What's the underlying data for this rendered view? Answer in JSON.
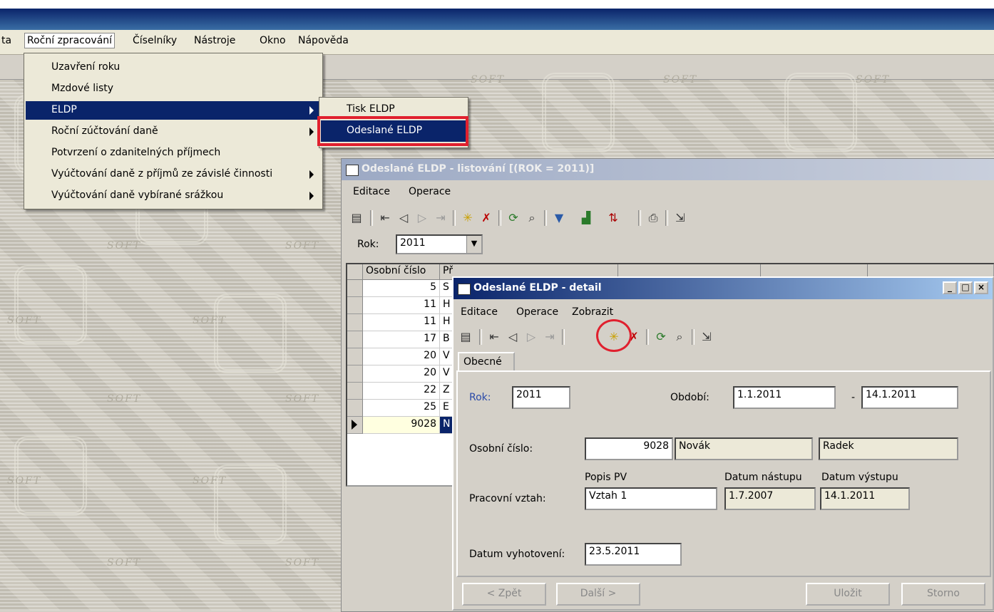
{
  "menubar": {
    "items": [
      "ta",
      "Roční zpracování",
      "Číselníky",
      "Nástroje",
      "Okno",
      "Nápověda"
    ]
  },
  "dropdown": {
    "items": [
      {
        "label": "Uzavření roku",
        "submenu": false
      },
      {
        "label": "Mzdové listy",
        "submenu": false
      },
      {
        "label": "ELDP",
        "submenu": true
      },
      {
        "label": "Roční zúčtování daně",
        "submenu": true
      },
      {
        "label": "Potvrzení o zdanitelných příjmech",
        "submenu": false
      },
      {
        "label": "Vyúčtování daně z příjmů ze závislé činnosti",
        "submenu": true
      },
      {
        "label": "Vyúčtování daně vybírané srážkou",
        "submenu": true
      }
    ]
  },
  "submenu": {
    "items": [
      "Tisk ELDP",
      "Odeslané ELDP"
    ]
  },
  "wallpaper": {
    "watermark": "SOFT"
  },
  "list_window": {
    "title": "Odeslané ELDP - listování [(ROK = 2011)]",
    "menu": [
      "Editace",
      "Operace"
    ],
    "filter_label": "Rok:",
    "filter_value": "2011",
    "columns": [
      "Osobní číslo",
      "Př",
      "",
      "",
      ""
    ],
    "rows": [
      {
        "id": "5",
        "p": "S"
      },
      {
        "id": "11",
        "p": "H"
      },
      {
        "id": "11",
        "p": "H"
      },
      {
        "id": "17",
        "p": "B"
      },
      {
        "id": "20",
        "p": "V"
      },
      {
        "id": "20",
        "p": "V"
      },
      {
        "id": "22",
        "p": "Z"
      },
      {
        "id": "25",
        "p": "E"
      },
      {
        "id": "9028",
        "p": "N"
      }
    ]
  },
  "detail_window": {
    "title": "Odeslané ELDP - detail",
    "menu": [
      "Editace",
      "Operace",
      "Zobrazit"
    ],
    "tab": "Obecné",
    "rok_label": "Rok:",
    "rok_value": "2011",
    "obdobi_label": "Období:",
    "obdobi_from": "1.1.2011",
    "obdobi_dash": "-",
    "obdobi_to": "14.1.2011",
    "osobni_label": "Osobní číslo:",
    "osobni_value": "9028",
    "prijmeni": "Novák",
    "jmeno": "Radek",
    "popis_pv_label": "Popis PV",
    "datum_nastupu_label": "Datum nástupu",
    "datum_vystupu_label": "Datum výstupu",
    "pracovni_label": "Pracovní vztah:",
    "pracovni_value": "Vztah 1",
    "datum_nastupu": "1.7.2007",
    "datum_vystupu": "14.1.2011",
    "vyhotoveni_label": "Datum vyhotovení:",
    "vyhotoveni_value": "23.5.2011",
    "buttons": {
      "back": "< Zpět",
      "next": "Další >",
      "save": "Uložit",
      "cancel": "Storno"
    }
  }
}
